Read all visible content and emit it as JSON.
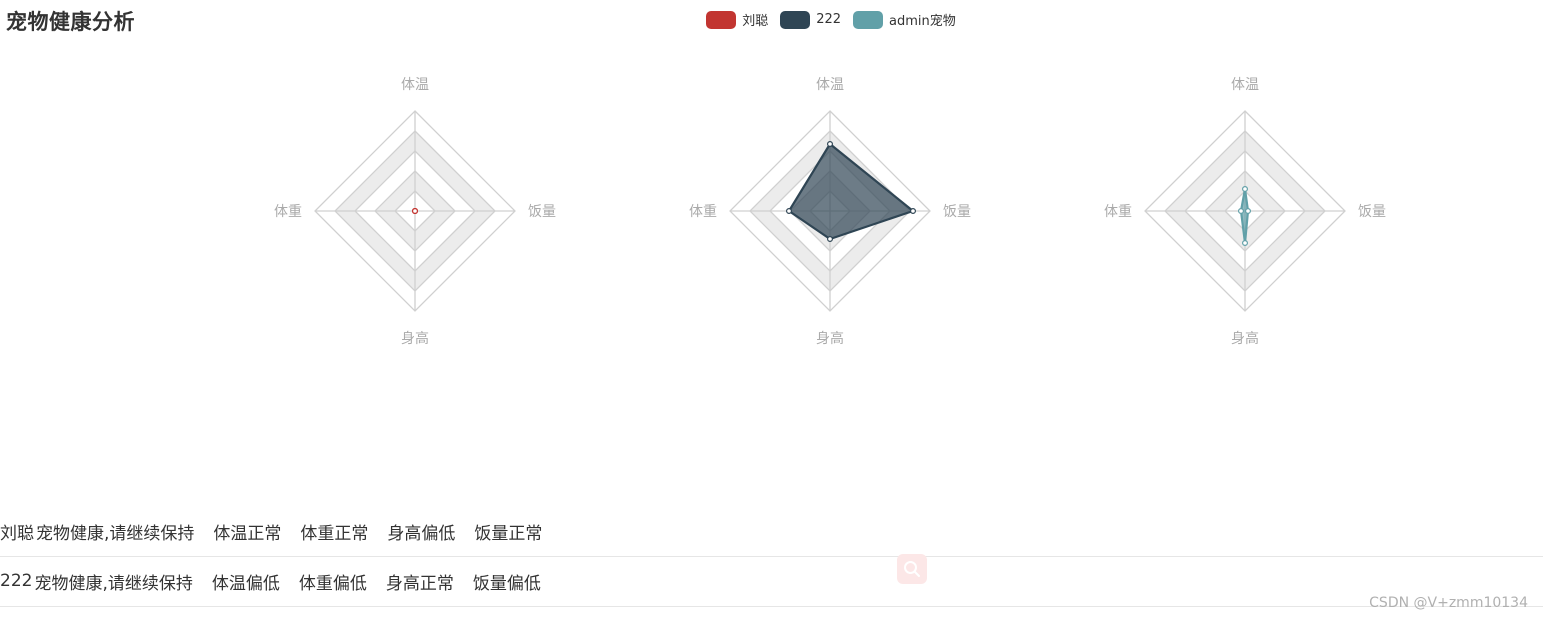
{
  "page": {
    "title": "宠物健康分析"
  },
  "legend": [
    {
      "label": "刘聪",
      "color": "#c23531"
    },
    {
      "label": "222",
      "color": "#2f4554"
    },
    {
      "label": "admin宠物",
      "color": "#61a0a8"
    }
  ],
  "chart_data": {
    "type": "radar",
    "indicators": [
      "体温",
      "饭量",
      "身高",
      "体重"
    ],
    "max": 100,
    "split_number": 5,
    "series": [
      {
        "name": "刘聪",
        "values": [
          0,
          0,
          0,
          0
        ],
        "color": "#c23531"
      },
      {
        "name": "222",
        "values": [
          67,
          83,
          28,
          41
        ],
        "color": "#2f4554"
      },
      {
        "name": "admin宠物",
        "values": [
          22,
          3,
          32,
          4
        ],
        "color": "#61a0a8"
      }
    ]
  },
  "reports": [
    {
      "name": "刘聪",
      "summary": "宠物健康,请继续保持",
      "items": [
        "体温正常",
        "体重正常",
        "身高偏低",
        "饭量正常"
      ]
    },
    {
      "name": "222",
      "summary": "宠物健康,请继续保持",
      "items": [
        "体温偏低",
        "体重偏低",
        "身高正常",
        "饭量偏低"
      ]
    }
  ],
  "search_button": {
    "icon": "search-icon"
  },
  "watermark": "CSDN @V+zmm10134"
}
